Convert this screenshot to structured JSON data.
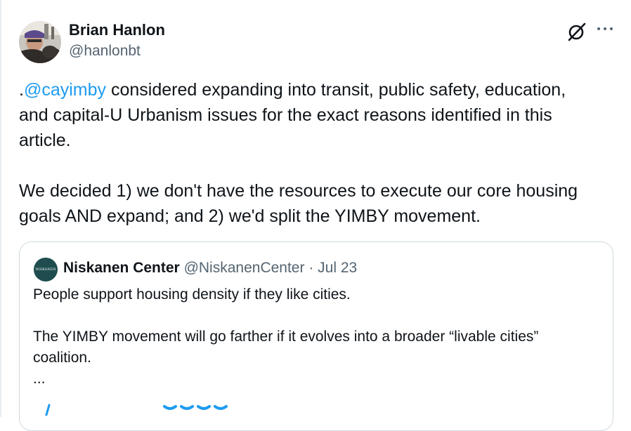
{
  "author": {
    "name": "Brian Hanlon",
    "handle": "@hanlonbt"
  },
  "icons": {
    "brand": "grok-slash-icon",
    "more": "more-dots-icon"
  },
  "tweet": {
    "prefix": ".",
    "mention": "@cayimby",
    "text": " considered expanding into transit, public safety, education,\nand capital-U Urbanism issues for the exact reasons identified in this\narticle.\n\nWe decided 1) we don't have the resources to execute our core housing\ngoals AND expand; and 2) we'd split the YIMBY movement."
  },
  "quote": {
    "avatar_text": "NISKANEN",
    "name": "Niskanen Center",
    "handle": "@NiskanenCenter",
    "separator": "·",
    "date": "Jul 23",
    "text": "People support housing density if they like cities.\n\nThe YIMBY movement will go farther if it evolves into a broader “livable cities”\ncoalition.\n..."
  },
  "colors": {
    "link": "#1d9bf0",
    "muted": "#536471",
    "border": "#cfd9de",
    "text": "#0f1419"
  }
}
